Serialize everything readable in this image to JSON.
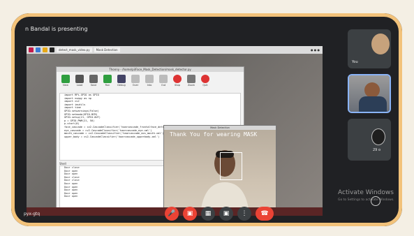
{
  "presenter_text": "n Bandal is presenting",
  "screen": {
    "thonny_title": "Thonny - /home/pi/Face_Mask_Detection/mask_detector.py",
    "editor_tab": "detect_mask_video.py",
    "tools": [
      "New",
      "Load",
      "Save",
      "Run",
      "Debug",
      "Over",
      "Into",
      "Out",
      "Stop",
      "Zoom",
      "Quit"
    ],
    "code_lines": [
      "import RPi.GPIO as GPIO",
      "import numpy as np",
      "import cv2",
      "import imutils",
      "import time",
      "GPIO.setwarnings(False)",
      "GPIO.setmode(GPIO.BCM)",
      "GPIO.setup(21, GPIO.OUT)",
      "p = GPIO.PWM(21, 50)",
      "p.start(0)",
      "",
      "face_cascade = cv2.CascadeClassifier('haarcascade_frontalface_default.xml')",
      "eye_cascade = cv2.CascadeClassifier('haarcascade_eye.xml')",
      "mouth_cascade = cv2.CascadeClassifier('haarcascade_mcs_mouth.xml')",
      "upper_body = cv2.CascadeClassifier('haarcascade_upperbody.xml')"
    ],
    "shell_tab": "Shell",
    "shell_lines": [
      "Door close",
      "Door open",
      "Door open",
      "Door close",
      "Door close",
      "Door open",
      "Door open",
      "Door open",
      "Door open",
      "Door open"
    ],
    "camera_title": "Mask Detection",
    "camera_text": "Thank You for wearing MASK"
  },
  "tiles": [
    {
      "label": "You"
    },
    {
      "label": ""
    },
    {
      "label": "29 o"
    }
  ],
  "meeting_code": "pyx-gtq",
  "watermark": {
    "title": "Activate Windows",
    "subtitle": "Go to Settings to activate Windows."
  },
  "colors": {
    "accent_red": "#ea4335",
    "tile_border": "#8ab4f8",
    "frame_corner": "#f2c27a"
  },
  "icons": {
    "mic": "mic-off-icon",
    "cam": "camera-off-icon",
    "cc": "captions-icon",
    "present": "present-icon",
    "more": "more-vert-icon",
    "end": "end-call-icon"
  }
}
